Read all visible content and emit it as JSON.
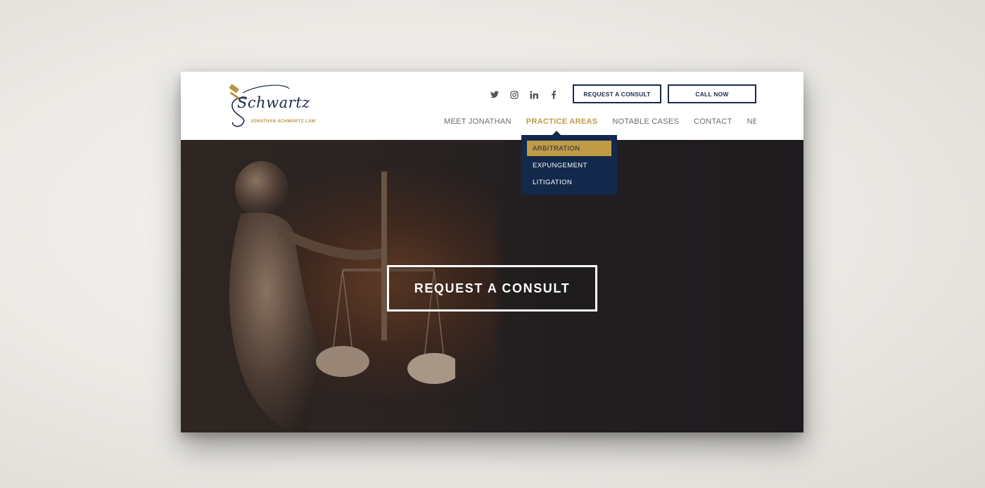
{
  "logo": {
    "script_text": "Schwartz",
    "subtitle": "JONATHAN SCHWARTZ LAW"
  },
  "social": [
    {
      "icon": "twitter-icon"
    },
    {
      "icon": "instagram-icon"
    },
    {
      "icon": "linkedin-icon"
    },
    {
      "icon": "facebook-icon"
    }
  ],
  "header_buttons": {
    "consult_label": "REQUEST A CONSULT",
    "call_label": "CALL NOW"
  },
  "nav": {
    "items": [
      {
        "label": "MEET JONATHAN"
      },
      {
        "label": "PRACTICE AREAS",
        "active": true
      },
      {
        "label": "NOTABLE CASES"
      },
      {
        "label": "CONTACT"
      },
      {
        "label": "NEWS"
      }
    ]
  },
  "dropdown": {
    "items": [
      {
        "label": "ARBITRATION",
        "selected": true
      },
      {
        "label": "EXPUNGEMENT"
      },
      {
        "label": "LITIGATION"
      }
    ]
  },
  "hero": {
    "cta_label": "REQUEST A CONSULT"
  },
  "colors": {
    "navy": "#13294b",
    "gold": "#c19a45",
    "white": "#ffffff"
  }
}
